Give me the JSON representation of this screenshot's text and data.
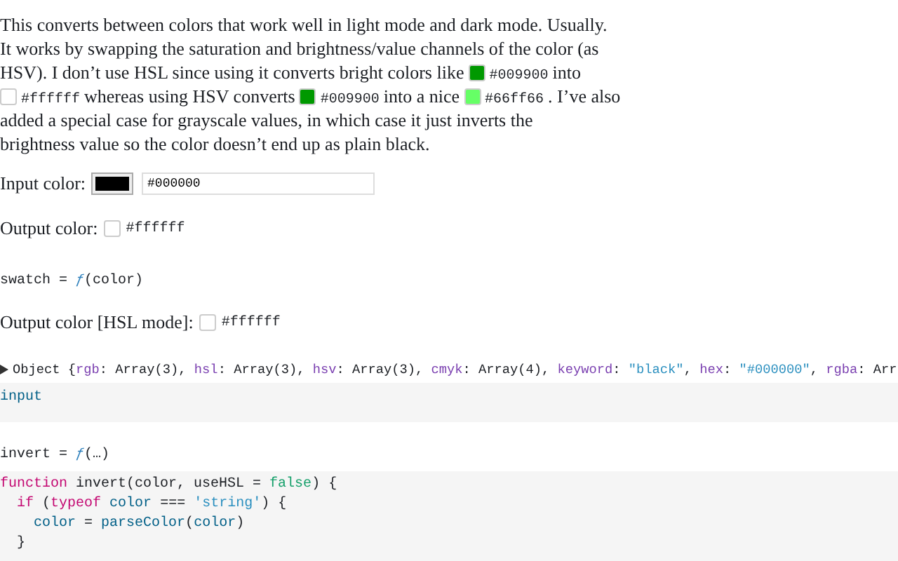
{
  "intro": [
    [
      {
        "kind": "text",
        "text": "This converts between colors that work well in light mode and dark mode. Usually."
      }
    ],
    [
      {
        "kind": "text",
        "text": "It works by swapping the saturation and brightness/value channels of the color (as"
      }
    ],
    [
      {
        "kind": "text",
        "text": "HSV). I don’t use HSL since using it converts bright colors like"
      },
      {
        "kind": "swatch",
        "color": "#009900",
        "code": "#009900"
      },
      {
        "kind": "text",
        "text": "into"
      }
    ],
    [
      {
        "kind": "swatch",
        "color": "#ffffff",
        "code": "#ffffff"
      },
      {
        "kind": "text",
        "text": "whereas using HSV converts"
      },
      {
        "kind": "swatch",
        "color": "#009900",
        "code": "#009900"
      },
      {
        "kind": "text",
        "text": "into a nice"
      },
      {
        "kind": "swatch",
        "color": "#66ff66",
        "code": "#66ff66"
      },
      {
        "kind": "text",
        "text": ". I’ve also"
      }
    ],
    [
      {
        "kind": "text",
        "text": "added a special case for grayscale values, in which case it just inverts the"
      }
    ],
    [
      {
        "kind": "text",
        "text": "brightness value so the color doesn’t end up as plain black."
      }
    ]
  ],
  "input_color": {
    "label": "Input color:",
    "color": "#000000",
    "value": "#000000"
  },
  "output_color": {
    "label": "Output color:",
    "color": "#ffffff",
    "code": "#ffffff"
  },
  "swatch_cell": [
    {
      "kind": "plain",
      "text": "swatch = "
    },
    {
      "kind": "fn",
      "text": "ƒ"
    },
    {
      "kind": "plain",
      "text": "(color)"
    }
  ],
  "output_hsl": {
    "label": "Output color [HSL mode]:",
    "color": "#ffffff",
    "code": "#ffffff"
  },
  "inspector": {
    "expanded": false,
    "tokens": [
      {
        "kind": "plain",
        "text": "Object {"
      },
      {
        "kind": "key",
        "text": "rgb"
      },
      {
        "kind": "plain",
        "text": ": Array(3), "
      },
      {
        "kind": "key",
        "text": "hsl"
      },
      {
        "kind": "plain",
        "text": ": Array(3), "
      },
      {
        "kind": "key",
        "text": "hsv"
      },
      {
        "kind": "plain",
        "text": ": Array(3), "
      },
      {
        "kind": "key",
        "text": "cmyk"
      },
      {
        "kind": "plain",
        "text": ": Array(4), "
      },
      {
        "kind": "key",
        "text": "keyword"
      },
      {
        "kind": "plain",
        "text": ": "
      },
      {
        "kind": "string",
        "text": "\"black\""
      },
      {
        "kind": "plain",
        "text": ", "
      },
      {
        "kind": "key",
        "text": "hex"
      },
      {
        "kind": "plain",
        "text": ": "
      },
      {
        "kind": "string",
        "text": "\"#000000\""
      },
      {
        "kind": "plain",
        "text": ", "
      },
      {
        "kind": "key",
        "text": "rgba"
      },
      {
        "kind": "plain",
        "text": ": Arr"
      }
    ]
  },
  "input_source": [
    [
      {
        "kind": "name",
        "text": "input"
      }
    ]
  ],
  "invert_cell": [
    {
      "kind": "plain",
      "text": "invert = "
    },
    {
      "kind": "fn",
      "text": "ƒ"
    },
    {
      "kind": "plain",
      "text": "(…)"
    }
  ],
  "invert_source": [
    [
      {
        "kind": "keyword",
        "text": "function"
      },
      {
        "kind": "plain",
        "text": " invert(color, useHSL = "
      },
      {
        "kind": "literal",
        "text": "false"
      },
      {
        "kind": "plain",
        "text": ") {"
      }
    ],
    [
      {
        "kind": "keyword",
        "text": "  if"
      },
      {
        "kind": "plain",
        "text": " ("
      },
      {
        "kind": "keyword",
        "text": "typeof"
      },
      {
        "kind": "name",
        "text": " color"
      },
      {
        "kind": "plain",
        "text": " === "
      },
      {
        "kind": "string",
        "text": "'string'"
      },
      {
        "kind": "plain",
        "text": ") {"
      }
    ],
    [
      {
        "kind": "name",
        "text": "    color"
      },
      {
        "kind": "plain",
        "text": " = "
      },
      {
        "kind": "name",
        "text": "parseColor"
      },
      {
        "kind": "plain",
        "text": "("
      },
      {
        "kind": "name",
        "text": "color"
      },
      {
        "kind": "plain",
        "text": ")"
      }
    ],
    [
      {
        "kind": "plain",
        "text": "  }"
      }
    ]
  ]
}
